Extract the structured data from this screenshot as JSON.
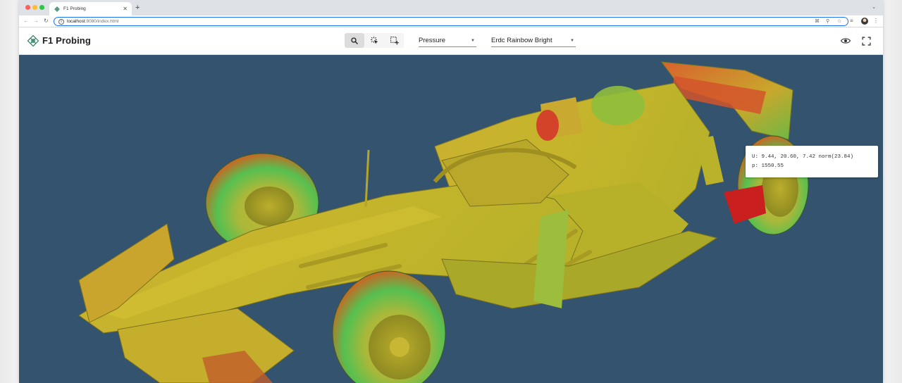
{
  "browser": {
    "tab_title": "F1 Probing",
    "new_tab_label": "+",
    "url_host": "localhost",
    "url_rest": ":8080/index.html",
    "back_icon": "arrow-left-icon",
    "forward_icon": "arrow-right-icon",
    "reload_icon": "reload-icon",
    "site_info_icon": "info-icon",
    "install_icon": "install-app-icon",
    "zoom_icon": "zoom-icon",
    "bookmark_icon": "star-icon",
    "tab_list_icon": "tab-list-icon",
    "menu_icon": "kebab-menu-icon"
  },
  "app": {
    "title": "F1 Probing",
    "logo_icon": "molecule-logo-icon",
    "tools": [
      {
        "name": "probe-tool",
        "icon": "search-icon",
        "active": true
      },
      {
        "name": "pick-point-tool",
        "icon": "pointer-select-icon",
        "active": false
      },
      {
        "name": "box-select-tool",
        "icon": "box-select-icon",
        "active": false
      }
    ],
    "field_select": {
      "value": "Pressure"
    },
    "colormap_select": {
      "value": "Erdc Rainbow Bright"
    },
    "visibility_icon": "eye-icon",
    "fullscreen_icon": "fullscreen-icon"
  },
  "viewport": {
    "background_color": "#34536e",
    "probe_tooltip": {
      "line1": "U: 9.44, 20.60, 7.42  norm(23.84)",
      "line2": "p: 1550.55"
    }
  },
  "colors": {
    "accent": "#1a73e8",
    "surface_yellow": "#c8b52a",
    "surface_green": "#5fc24a",
    "surface_red": "#d23a2a"
  }
}
